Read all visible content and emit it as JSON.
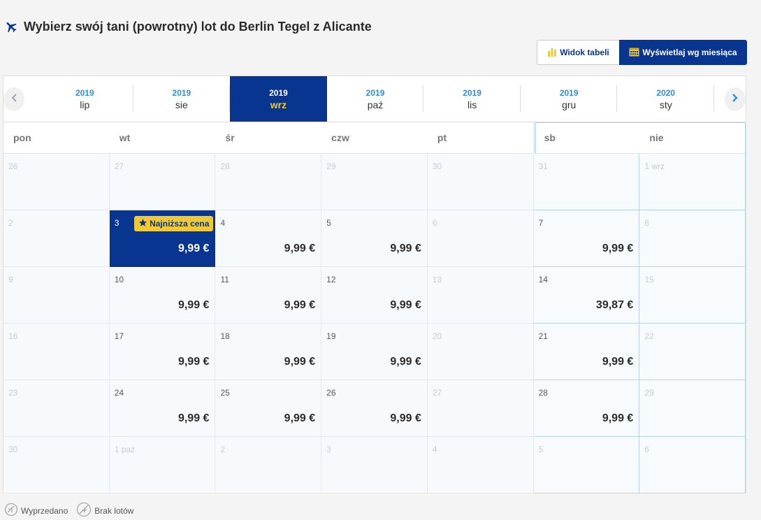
{
  "header": {
    "title": "Wybierz swój tani (powrotny) lot do Berlin Tegel z Alicante",
    "icon": "plane-icon"
  },
  "view_toggle": {
    "table_label": "Widok tabeli",
    "month_label": "Wyświetlaj wg miesiąca"
  },
  "months": [
    {
      "year": "2019",
      "month": "lip"
    },
    {
      "year": "2019",
      "month": "sie"
    },
    {
      "year": "2019",
      "month": "wrz",
      "active": true
    },
    {
      "year": "2019",
      "month": "paź"
    },
    {
      "year": "2019",
      "month": "lis"
    },
    {
      "year": "2019",
      "month": "gru"
    },
    {
      "year": "2020",
      "month": "sty"
    }
  ],
  "weekdays": [
    "pon",
    "wt",
    "śr",
    "czw",
    "pt",
    "sb",
    "nie"
  ],
  "badge_label": "Najniższa cena",
  "weeks": [
    [
      {
        "day": "26",
        "off": true
      },
      {
        "day": "27",
        "off": true
      },
      {
        "day": "28",
        "off": true
      },
      {
        "day": "29",
        "off": true
      },
      {
        "day": "30",
        "off": true
      },
      {
        "day": "31",
        "off": true
      },
      {
        "day": "1 wrz",
        "off": true
      }
    ],
    [
      {
        "day": "2",
        "off": true
      },
      {
        "day": "3",
        "price": "9,99 €",
        "selected": true,
        "badge": true
      },
      {
        "day": "4",
        "price": "9,99 €"
      },
      {
        "day": "5",
        "price": "9,99 €"
      },
      {
        "day": "6",
        "off": true
      },
      {
        "day": "7",
        "price": "9,99 €"
      },
      {
        "day": "8",
        "off": true
      }
    ],
    [
      {
        "day": "9",
        "off": true
      },
      {
        "day": "10",
        "price": "9,99 €"
      },
      {
        "day": "11",
        "price": "9,99 €"
      },
      {
        "day": "12",
        "price": "9,99 €"
      },
      {
        "day": "13",
        "off": true
      },
      {
        "day": "14",
        "price": "39,87 €"
      },
      {
        "day": "15",
        "off": true
      }
    ],
    [
      {
        "day": "16",
        "off": true
      },
      {
        "day": "17",
        "price": "9,99 €"
      },
      {
        "day": "18",
        "price": "9,99 €"
      },
      {
        "day": "19",
        "price": "9,99 €"
      },
      {
        "day": "20",
        "off": true
      },
      {
        "day": "21",
        "price": "9,99 €"
      },
      {
        "day": "22",
        "off": true
      }
    ],
    [
      {
        "day": "23",
        "off": true
      },
      {
        "day": "24",
        "price": "9,99 €"
      },
      {
        "day": "25",
        "price": "9,99 €"
      },
      {
        "day": "26",
        "price": "9,99 €"
      },
      {
        "day": "27",
        "off": true
      },
      {
        "day": "28",
        "price": "9,99 €"
      },
      {
        "day": "29",
        "off": true
      }
    ],
    [
      {
        "day": "30",
        "off": true
      },
      {
        "day": "1 paź",
        "off": true
      },
      {
        "day": "2",
        "off": true
      },
      {
        "day": "3",
        "off": true
      },
      {
        "day": "4",
        "off": true
      },
      {
        "day": "5",
        "off": true
      },
      {
        "day": "6",
        "off": true
      }
    ]
  ],
  "legend": {
    "sold_out": "Wyprzedano",
    "no_flights": "Brak lotów"
  },
  "colors": {
    "primary": "#073590",
    "accent": "#f1c933",
    "year": "#2d8fd5"
  }
}
